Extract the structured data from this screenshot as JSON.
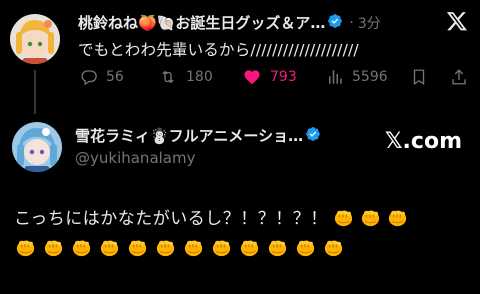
{
  "tweet": {
    "author_name": "桃鈴ねね🍑🐚お誕生日グッズ＆ア…",
    "separator": "·",
    "time": "3分",
    "text": "でもとわわ先輩いるから////////////////////",
    "counts": {
      "replies": "56",
      "retweets": "180",
      "likes": "793",
      "views": "5596"
    },
    "like_color": "#f91880"
  },
  "quoted": {
    "author_name": "雪花ラミィ☃️フルアニメーショ…",
    "handle": "@yukihanalamy",
    "brand": "𝕏.com",
    "text": "こっちにはかなたがいるし？！？！？！",
    "fist_emoji_count_inline": 3,
    "fist_emoji_count_row": 12
  },
  "colors": {
    "background": "#000000",
    "text": "#e7e9ea",
    "muted": "#71767b",
    "verified": "#1d9bf0"
  }
}
